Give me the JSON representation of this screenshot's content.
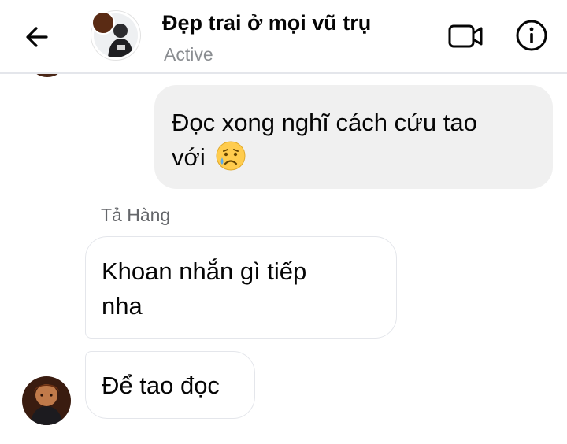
{
  "header": {
    "title": "Đẹp trai ở mọi vũ trụ",
    "status": "Active"
  },
  "messages": [
    {
      "direction": "outgoing",
      "line1": "Đọc xong nghĩ cách cứu tao",
      "line2": "với",
      "emoji": "sad-but-relieved-face"
    },
    {
      "direction": "incoming",
      "sender": "Tả Hàng",
      "line1": "Khoan nhắn gì tiếp",
      "line2": "nha"
    },
    {
      "direction": "incoming",
      "line1": "Để tao đọc"
    }
  ],
  "colors": {
    "outgoing_bubble": "#f0f0f0",
    "incoming_border": "#e4e6eb",
    "secondary_text": "#65676b",
    "status_text": "#8a8d91"
  }
}
